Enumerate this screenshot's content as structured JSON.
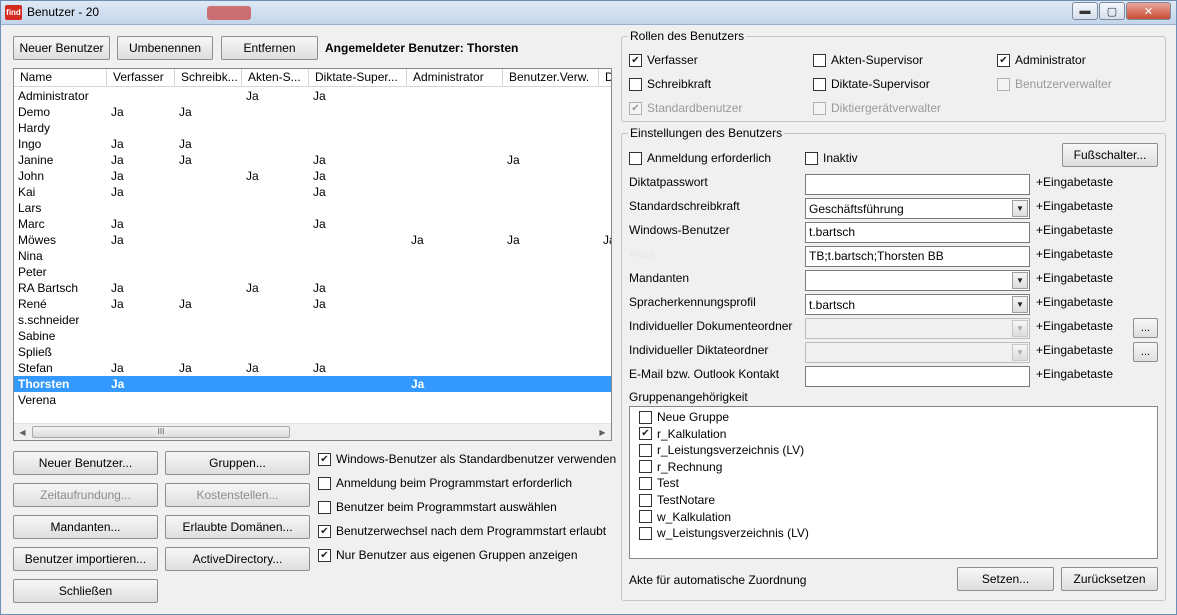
{
  "window": {
    "title": "Benutzer - 20",
    "app_icon": "find"
  },
  "toolbar": {
    "new_user": "Neuer Benutzer",
    "rename": "Umbenennen",
    "remove": "Entfernen",
    "logged_in": "Angemeldeter Benutzer: Thorsten"
  },
  "table": {
    "columns": [
      "Name",
      "Verfasser",
      "Schreibk...",
      "Akten-S...",
      "Diktate-Super...",
      "Administrator",
      "Benutzer.Verw.",
      "Di"
    ],
    "rows": [
      [
        "Administrator",
        "",
        "",
        "Ja",
        "Ja",
        "",
        "",
        ""
      ],
      [
        "Demo",
        "Ja",
        "Ja",
        "",
        "",
        "",
        "",
        ""
      ],
      [
        "Hardy",
        "",
        "",
        "",
        "",
        "",
        "",
        ""
      ],
      [
        "Ingo",
        "Ja",
        "Ja",
        "",
        "",
        "",
        "",
        ""
      ],
      [
        "Janine",
        "Ja",
        "Ja",
        "",
        "Ja",
        "",
        "Ja",
        ""
      ],
      [
        "John",
        "Ja",
        "",
        "Ja",
        "Ja",
        "",
        "",
        ""
      ],
      [
        "Kai",
        "Ja",
        "",
        "",
        "Ja",
        "",
        "",
        ""
      ],
      [
        "Lars",
        "",
        "",
        "",
        "",
        "",
        "",
        ""
      ],
      [
        "Marc",
        "Ja",
        "",
        "",
        "Ja",
        "",
        "",
        ""
      ],
      [
        "Möwes",
        "Ja",
        "",
        "",
        "",
        "Ja",
        "Ja",
        "Ja"
      ],
      [
        "Nina",
        "",
        "",
        "",
        "",
        "",
        "",
        ""
      ],
      [
        "Peter",
        "",
        "",
        "",
        "",
        "",
        "",
        ""
      ],
      [
        "RA Bartsch",
        "Ja",
        "",
        "Ja",
        "Ja",
        "",
        "",
        ""
      ],
      [
        "René",
        "Ja",
        "Ja",
        "",
        "Ja",
        "",
        "",
        ""
      ],
      [
        "s.schneider",
        "",
        "",
        "",
        "",
        "",
        "",
        ""
      ],
      [
        "Sabine",
        "",
        "",
        "",
        "",
        "",
        "",
        ""
      ],
      [
        "Spließ",
        "",
        "",
        "",
        "",
        "",
        "",
        ""
      ],
      [
        "Stefan",
        "Ja",
        "Ja",
        "Ja",
        "Ja",
        "",
        "",
        ""
      ],
      [
        "Thorsten",
        "Ja",
        "",
        "",
        "",
        "Ja",
        "",
        ""
      ],
      [
        "Verena",
        "",
        "",
        "",
        "",
        "",
        "",
        ""
      ]
    ],
    "selected_row": "Thorsten",
    "scroll_grip": "III"
  },
  "bottom_buttons": {
    "new_user": "Neuer Benutzer...",
    "groups": "Gruppen...",
    "rounding": "Zeitaufrundung...",
    "cost_centers": "Kostenstellen...",
    "clients": "Mandanten...",
    "domains": "Erlaubte Domänen...",
    "import": "Benutzer importieren...",
    "active_directory": "ActiveDirectory...",
    "close": "Schließen"
  },
  "options": [
    {
      "label": "Windows-Benutzer als Standardbenutzer verwenden",
      "checked": true
    },
    {
      "label": "Anmeldung beim Programmstart erforderlich",
      "checked": false
    },
    {
      "label": "Benutzer beim Programmstart auswählen",
      "checked": false
    },
    {
      "label": "Benutzerwechsel nach dem Programmstart erlaubt",
      "checked": true
    },
    {
      "label": "Nur Benutzer aus eigenen Gruppen anzeigen",
      "checked": true
    }
  ],
  "roles": {
    "title": "Rollen des Benutzers",
    "items": [
      {
        "label": "Verfasser",
        "checked": true,
        "enabled": true
      },
      {
        "label": "Akten-Supervisor",
        "checked": false,
        "enabled": true
      },
      {
        "label": "Administrator",
        "checked": true,
        "enabled": true
      },
      {
        "label": "Schreibkraft",
        "checked": false,
        "enabled": true
      },
      {
        "label": "Diktate-Supervisor",
        "checked": false,
        "enabled": true
      },
      {
        "label": "Benutzerverwalter",
        "checked": false,
        "enabled": false
      },
      {
        "label": "Standardbenutzer",
        "checked": true,
        "enabled": false
      },
      {
        "label": "Diktiergerätverwalter",
        "checked": false,
        "enabled": false
      }
    ]
  },
  "settings": {
    "title": "Einstellungen des Benutzers",
    "login_required": {
      "label": "Anmeldung erforderlich",
      "checked": false
    },
    "inactive": {
      "label": "Inaktiv",
      "checked": false
    },
    "footswitch": "Fußschalter...",
    "enter_suffix": "+Eingabetaste",
    "fields": [
      {
        "label": "Diktatpasswort",
        "value": "",
        "type": "text",
        "enabled": true
      },
      {
        "label": "Standardschreibkraft",
        "value": "Geschäftsführung",
        "type": "combo",
        "enabled": true
      },
      {
        "label": "Windows-Benutzer",
        "value": "t.bartsch",
        "type": "text",
        "enabled": true
      },
      {
        "label": "Alias",
        "value": "TB;t.bartsch;Thorsten BB",
        "type": "text",
        "enabled": true
      },
      {
        "label": "Mandanten",
        "value": "",
        "type": "combo",
        "enabled": true
      },
      {
        "label": "Spracherkennungsprofil",
        "value": "t.bartsch",
        "type": "combo",
        "enabled": true
      },
      {
        "label": "Individueller Dokumenteordner",
        "value": "",
        "type": "combo",
        "enabled": false
      },
      {
        "label": "Individueller Diktateordner",
        "value": "",
        "type": "combo",
        "enabled": false
      },
      {
        "label": "E-Mail bzw. Outlook Kontakt",
        "value": "",
        "type": "text",
        "enabled": true
      }
    ],
    "browse": "...",
    "groups_label": "Gruppenangehörigkeit",
    "groups": [
      {
        "label": "Neue Gruppe",
        "checked": false
      },
      {
        "label": "r_Kalkulation",
        "checked": true
      },
      {
        "label": "r_Leistungsverzeichnis (LV)",
        "checked": false
      },
      {
        "label": "r_Rechnung",
        "checked": false
      },
      {
        "label": "Test",
        "checked": false
      },
      {
        "label": "TestNotare",
        "checked": false
      },
      {
        "label": "w_Kalkulation",
        "checked": false
      },
      {
        "label": "w_Leistungsverzeichnis (LV)",
        "checked": false
      }
    ],
    "auto_assign": "Akte für automatische Zuordnung",
    "set": "Setzen...",
    "reset": "Zurücksetzen"
  },
  "icons": [
    "app-icon",
    "minimize-icon",
    "maximize-icon",
    "close-icon",
    "chevron-down-icon",
    "scroll-left-icon",
    "scroll-right-icon",
    "checkmark-icon"
  ]
}
